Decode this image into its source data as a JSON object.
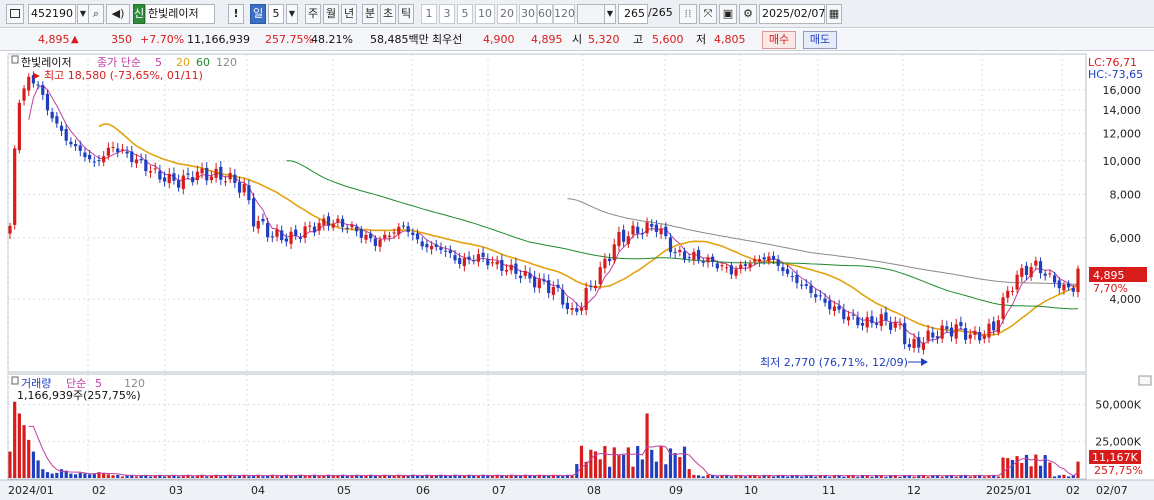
{
  "toolbar": {
    "code": "452190",
    "search_icon": "search-icon",
    "badge": "신",
    "stock_name": "한빛레이저",
    "alert": "!",
    "period_day": "일",
    "period_n": "5",
    "period_week": "주",
    "period_month": "월",
    "period_year": "년",
    "period_min": "분",
    "period_sec": "초",
    "period_tick": "틱",
    "intervals": [
      "1",
      "3",
      "5",
      "10",
      "20",
      "30",
      "60",
      "120"
    ],
    "count": "265",
    "total": "/265",
    "date": "2025/02/07"
  },
  "quote": {
    "price": "4,895",
    "change": "350",
    "change_pct": "+7.70%",
    "volume": "11,166,939",
    "volume_pct": "257.75%",
    "turnover": "48.21%",
    "amount": "58,485백만",
    "best_label": "최우선",
    "best_ask": "4,900",
    "best_bid": "4,895",
    "open_label": "시",
    "open": "5,320",
    "high_label": "고",
    "high": "5,600",
    "low_label": "저",
    "low": "4,805",
    "buy": "매수",
    "sell": "매도"
  },
  "price_panel": {
    "stock_name": "한빛레이저",
    "ma_label": "종가 단순",
    "ma_periods": [
      "5",
      "20",
      "60",
      "120"
    ],
    "lc": "LC:76,71",
    "hc": "HC:-73,65",
    "high_note": "최고 18,580 (-73,65%, 01/11)",
    "low_note": "최저 2,770 (76,71%, 12/09)",
    "last_price": "4,895",
    "last_pct": "7,70%",
    "y_ticks": [
      "16,000",
      "14,000",
      "12,000",
      "10,000",
      "8,000",
      "6,000",
      "4,000"
    ]
  },
  "volume_panel": {
    "title": "거래량",
    "ma_label": "단순",
    "ma_periods": [
      "5",
      "120"
    ],
    "value_note": "1,166,939주(257,75%)",
    "y_ticks": [
      "50,000K",
      "25,000K"
    ],
    "last_volume": "11,167K",
    "last_pct": "257,75%"
  },
  "x_axis": {
    "labels": [
      "2024/01",
      "02",
      "03",
      "04",
      "05",
      "06",
      "07",
      "08",
      "09",
      "10",
      "11",
      "12",
      "2025/01",
      "02",
      "02/07"
    ]
  },
  "chart_data": {
    "type": "candlestick",
    "price_scale": "log",
    "ylim": [
      2500,
      19000
    ],
    "price_ticks": [
      16000,
      14000,
      12000,
      10000,
      8000,
      6000,
      4000
    ],
    "high": 18580,
    "low": 2770,
    "last": 4895,
    "months": [
      "2024/01",
      "02",
      "03",
      "04",
      "05",
      "06",
      "07",
      "08",
      "09",
      "10",
      "11",
      "12",
      "2025/01",
      "02"
    ],
    "close_path": [
      [
        0,
        6500
      ],
      [
        2,
        15000
      ],
      [
        4,
        17200
      ],
      [
        6,
        16600
      ],
      [
        8,
        14000
      ],
      [
        12,
        11500
      ],
      [
        18,
        9800
      ],
      [
        22,
        11000
      ],
      [
        26,
        10200
      ],
      [
        32,
        9000
      ],
      [
        36,
        8700
      ],
      [
        40,
        9200
      ],
      [
        46,
        9000
      ],
      [
        50,
        8300
      ],
      [
        52,
        6800
      ],
      [
        56,
        6100
      ],
      [
        60,
        6000
      ],
      [
        64,
        6400
      ],
      [
        68,
        6700
      ],
      [
        72,
        6500
      ],
      [
        78,
        5800
      ],
      [
        84,
        6500
      ],
      [
        88,
        5700
      ],
      [
        92,
        5600
      ],
      [
        96,
        5100
      ],
      [
        100,
        5300
      ],
      [
        104,
        5000
      ],
      [
        108,
        4800
      ],
      [
        112,
        4500
      ],
      [
        116,
        4300
      ],
      [
        118,
        4000
      ],
      [
        120,
        3600
      ],
      [
        122,
        3900
      ],
      [
        126,
        4800
      ],
      [
        130,
        6000
      ],
      [
        134,
        6300
      ],
      [
        138,
        6500
      ],
      [
        142,
        5400
      ],
      [
        146,
        5300
      ],
      [
        150,
        5100
      ],
      [
        154,
        4800
      ],
      [
        158,
        5100
      ],
      [
        162,
        5300
      ],
      [
        166,
        4700
      ],
      [
        170,
        4300
      ],
      [
        174,
        3900
      ],
      [
        178,
        3600
      ],
      [
        182,
        3400
      ],
      [
        186,
        3500
      ],
      [
        190,
        3300
      ],
      [
        192,
        2900
      ],
      [
        194,
        3000
      ],
      [
        198,
        3200
      ],
      [
        202,
        3300
      ],
      [
        206,
        3100
      ],
      [
        210,
        3300
      ],
      [
        213,
        4200
      ],
      [
        216,
        4800
      ],
      [
        219,
        5000
      ],
      [
        222,
        4600
      ],
      [
        225,
        4300
      ],
      [
        227,
        4300
      ],
      [
        228,
        5400
      ]
    ],
    "volume_k": [
      18000,
      52000,
      44000,
      36000,
      26000,
      18000,
      12000,
      6000,
      4000,
      3000,
      3500,
      6000,
      5000,
      3000,
      2500,
      3500,
      3000,
      2500,
      3000,
      4000,
      3500,
      2500
    ],
    "volume_ylim": [
      0,
      60000
    ],
    "volume_ticks": [
      50000,
      25000
    ],
    "last_volume_k": 11167
  },
  "colors": {
    "up": "#d81b1b",
    "down": "#1f3fbf",
    "ma5": "#c03ea0",
    "ma20": "#e3a20f",
    "ma60": "#1f8a2b",
    "ma120": "#8a8a8a",
    "grid": "#d9dee6"
  }
}
